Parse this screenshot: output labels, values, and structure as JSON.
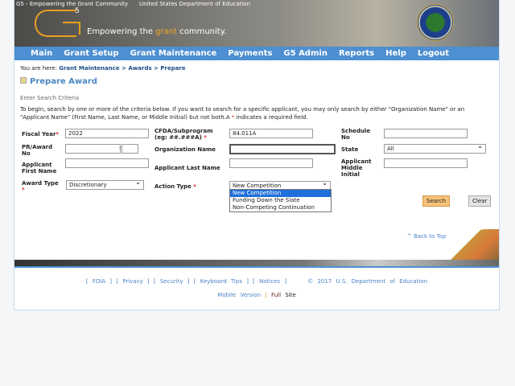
{
  "header": {
    "logo_alt": "G5 - Empowering the Grant Community",
    "seal_alt": "United States Department of Education",
    "logo_mark": "5",
    "tagline_pre": "Empowering the ",
    "tagline_accent": "grant",
    "tagline_post": " community."
  },
  "nav": [
    "Main",
    "Grant Setup",
    "Grant Maintenance",
    "Payments",
    "G5 Admin",
    "Reports",
    "Help",
    "Logout"
  ],
  "breadcrumb": {
    "prefix": "You are here: ",
    "path": "Grant Maintenance > Awards > Prepare"
  },
  "page_title": "Prepare Award",
  "section_title": "Enter Search Criteria",
  "instructions": {
    "text": "To begin, search by one or more of the criteria below. If you want to search for a specific applicant, you may only search by either \"Organization Name\" or an \"Applicant Name\" (First Name, Last Name, or Middle Initial) but not both.A ",
    "star": "*",
    "tail": " indicates a required field."
  },
  "form": {
    "fiscal_year_label": "Fiscal Year",
    "fiscal_year": "2022",
    "cfda_label": "CFDA/Subprogram (eg: ##.###A)",
    "cfda": "84.011A",
    "schedule_label": "Schedule No",
    "schedule": "",
    "pr_label": "PR/Award No",
    "pr_sep": "-",
    "org_label": "Organization Name",
    "org": "",
    "state_label": "State",
    "state": "All",
    "first_label": "Applicant First Name",
    "last_label": "Applicant Last Name",
    "middle_label": "Applicant Middle Initial",
    "award_type_label": "Award Type",
    "award_type": "Discretionary",
    "action_type_label": "Action Type",
    "action_type": "New Competition",
    "action_options": [
      "New Competition",
      "Funding Down the Slate",
      "Non-Competing Continuation"
    ],
    "required": "*"
  },
  "buttons": {
    "search": "Search",
    "clear": "Clear"
  },
  "back_to_top": "^ Back to Top",
  "footer": {
    "links": [
      "FOIA",
      "Privacy",
      "Security",
      "Keyboard Tips",
      "Notices"
    ],
    "copyright": "© 2017 U.S. Department of Education",
    "mobile": "Mobile Version",
    "sep": "|",
    "full": "Full",
    "site": "Site"
  },
  "colors": {
    "nav": "#4d8fd1",
    "accent": "#f3a52a",
    "search_button": "#f7c27a"
  }
}
